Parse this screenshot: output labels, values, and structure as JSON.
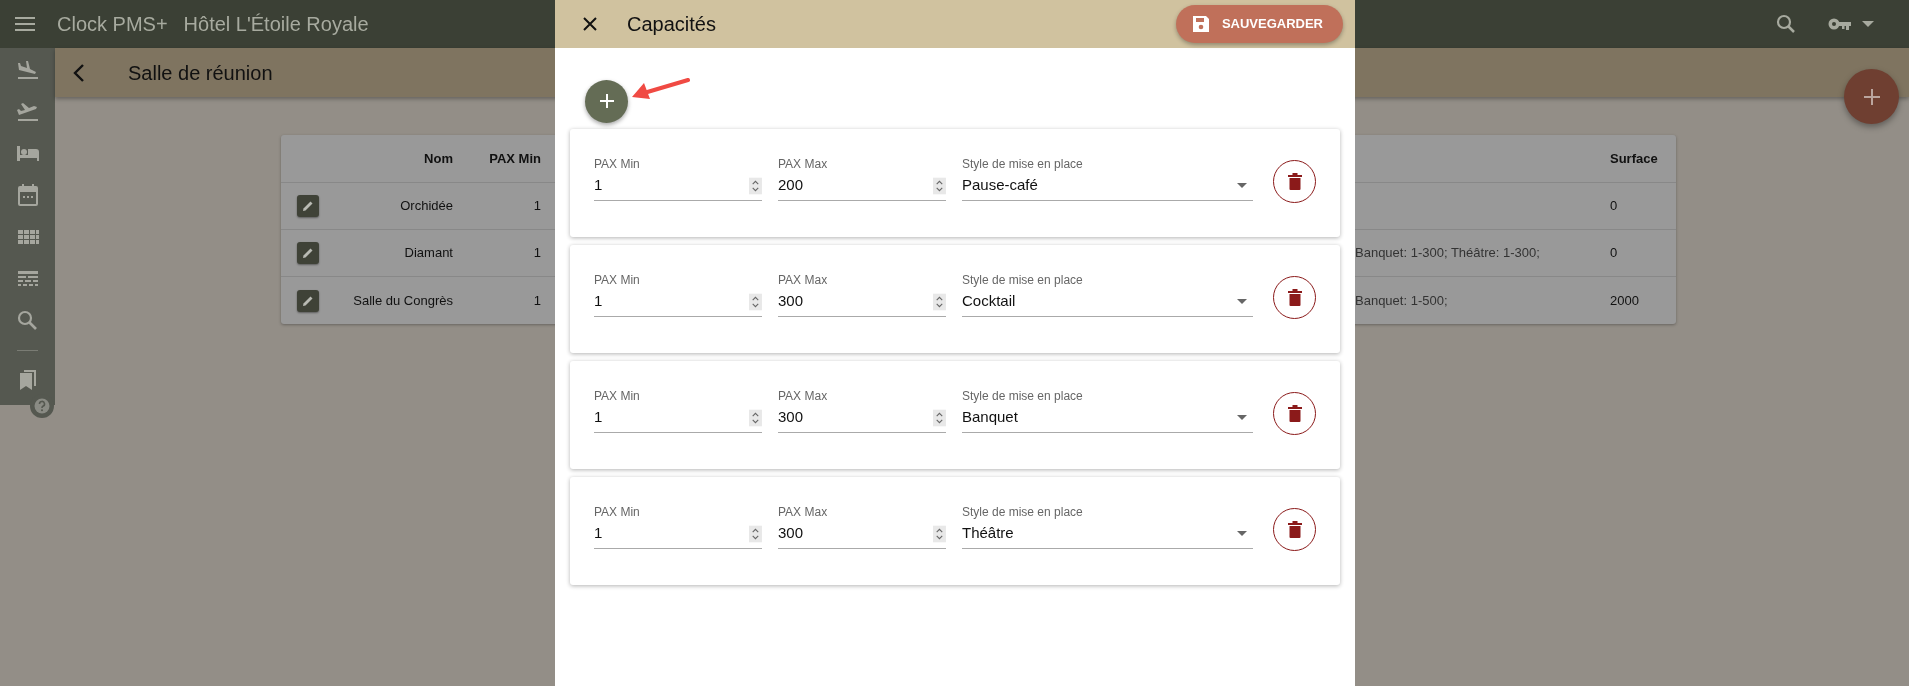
{
  "top_bar": {
    "app_name": "Clock PMS+",
    "hotel": "Hôtel L'Étoile Royale"
  },
  "page_header": {
    "title": "Salle de réunion"
  },
  "table": {
    "columns": [
      "Nom",
      "PAX Min",
      "Surface"
    ],
    "rows": [
      {
        "name": "Orchidée",
        "pax_min": "1",
        "surface": "0"
      },
      {
        "name": "Diamant",
        "pax_min": "1",
        "column_4": "Banquet: 1-300; Théâtre: 1-300;",
        "surface": "0"
      },
      {
        "name": "Salle du Congrès",
        "pax_min": "1",
        "column_4": "Banquet: 1-500;",
        "surface": "2000"
      }
    ]
  },
  "dialog": {
    "title": "Capacités",
    "save_label": "SAUVEGARDER",
    "capacities": [
      {
        "pax_min_label": "PAX Min",
        "pax_min": "1",
        "pax_max_label": "PAX Max",
        "pax_max": "200",
        "style_label": "Style de mise en place",
        "style": "Pause-café"
      },
      {
        "pax_min_label": "PAX Min",
        "pax_min": "1",
        "pax_max_label": "PAX Max",
        "pax_max": "300",
        "style_label": "Style de mise en place",
        "style": "Cocktail"
      },
      {
        "pax_min_label": "PAX Min",
        "pax_min": "1",
        "pax_max_label": "PAX Max",
        "pax_max": "300",
        "style_label": "Style de mise en place",
        "style": "Banquet"
      },
      {
        "pax_min_label": "PAX Min",
        "pax_min": "1",
        "pax_max_label": "PAX Max",
        "pax_max": "300",
        "style_label": "Style de mise en place",
        "style": "Théâtre"
      }
    ]
  }
}
